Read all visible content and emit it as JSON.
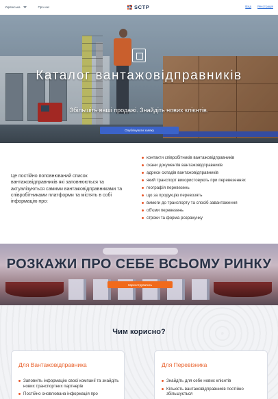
{
  "header": {
    "language": "Українська",
    "about": "Про нас",
    "logo_text": "SCTP",
    "login": "Вхід",
    "register": "Реєстрація"
  },
  "hero": {
    "title": "Каталог вантажовідправників",
    "subtitle": "Збільшіть ваші продажі. Знайдіть нових клієнтів.",
    "button": "Опублікувати заявку"
  },
  "info": {
    "description": "Це постійно поповнюваний список вантажовідправників які заповнюються та актуалізуються самими вантажовідправниками та співробітниками платформи та  містять в собі інформацію про:",
    "items": [
      "контакти співробітників вантажовідправників",
      "скани документів вантажовідправників",
      "адреси складів вантажовідправників",
      "який транспорт використовують при перевезеннях",
      "географія перевезень",
      "що за продукцію перевозять",
      "вимоги до транспорту та спосіб завантаження",
      "об'єми перевезень",
      "строки та форма розрахунку"
    ]
  },
  "banner": {
    "title": "РОЗКАЖИ ПРО СЕБЕ ВСЬОМУ РИНКУ",
    "button": "Зареєструватись"
  },
  "benefits": {
    "title": "Чим корисно?",
    "cards": [
      {
        "title": "Для Вантажовідправника",
        "items": [
          "Заповніть інформацію своєї компанії та знайдіть нових транспортних партнерів",
          "Постійно оновлювана інформація про"
        ]
      },
      {
        "title": "Для Перевізника",
        "items": [
          "Знайдіть для себе нових клієнтів",
          "Кількість вантажовідправників постійно збільшується"
        ]
      }
    ]
  },
  "colors": {
    "accent": "#e8572a",
    "primary_button": "#3b63c9",
    "banner_button": "#f06a1c",
    "link": "#2f6fd6"
  }
}
